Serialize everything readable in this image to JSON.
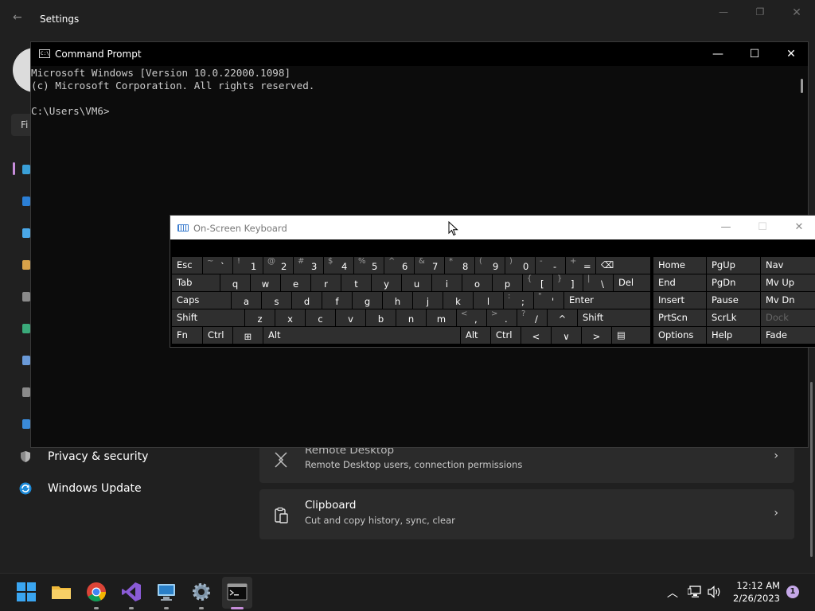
{
  "settings": {
    "title": "Settings",
    "find_placeholder_partial": "Fi",
    "nav": [
      {
        "label": "Privacy & security",
        "icon": "shield-icon"
      },
      {
        "label": "Windows Update",
        "icon": "windows-update-icon"
      }
    ],
    "cards": [
      {
        "title": "Remote Desktop",
        "subtitle": "Remote Desktop users, connection permissions",
        "icon": "remote-desktop-icon"
      },
      {
        "title": "Clipboard",
        "subtitle": "Cut and copy history, sync, clear",
        "icon": "clipboard-icon"
      }
    ],
    "accent_color": "#c78ddb"
  },
  "cmd": {
    "title": "Command Prompt",
    "lines": [
      "Microsoft Windows [Version 10.0.22000.1098]",
      "(c) Microsoft Corporation. All rights reserved.",
      "",
      "C:\\Users\\VM6>"
    ]
  },
  "osk": {
    "title": "On-Screen Keyboard",
    "rows": {
      "row1": [
        {
          "main": "Esc"
        },
        {
          "sh": "~",
          "main": "`"
        },
        {
          "sh": "!",
          "main": "1"
        },
        {
          "sh": "@",
          "main": "2"
        },
        {
          "sh": "#",
          "main": "3"
        },
        {
          "sh": "$",
          "main": "4"
        },
        {
          "sh": "%",
          "main": "5"
        },
        {
          "sh": "^",
          "main": "6"
        },
        {
          "sh": "&",
          "main": "7"
        },
        {
          "sh": "*",
          "main": "8"
        },
        {
          "sh": "(",
          "main": "9"
        },
        {
          "sh": ")",
          "main": "0"
        },
        {
          "sh": "-",
          "main": "-"
        },
        {
          "sh": "+",
          "main": "="
        },
        {
          "main": "⌫"
        }
      ],
      "row2": [
        {
          "main": "Tab"
        },
        {
          "main": "q"
        },
        {
          "main": "w"
        },
        {
          "main": "e"
        },
        {
          "main": "r"
        },
        {
          "main": "t"
        },
        {
          "main": "y"
        },
        {
          "main": "u"
        },
        {
          "main": "i"
        },
        {
          "main": "o"
        },
        {
          "main": "p"
        },
        {
          "sh": "{",
          "main": "["
        },
        {
          "sh": "}",
          "main": "]"
        },
        {
          "sh": "|",
          "main": "\\"
        },
        {
          "main": "Del"
        }
      ],
      "row3": [
        {
          "main": "Caps"
        },
        {
          "main": "a"
        },
        {
          "main": "s"
        },
        {
          "main": "d"
        },
        {
          "main": "f"
        },
        {
          "main": "g"
        },
        {
          "main": "h"
        },
        {
          "main": "j"
        },
        {
          "main": "k"
        },
        {
          "main": "l"
        },
        {
          "sh": ":",
          "main": ";"
        },
        {
          "sh": "\"",
          "main": "'"
        },
        {
          "main": "Enter"
        }
      ],
      "row4": [
        {
          "main": "Shift"
        },
        {
          "main": "z"
        },
        {
          "main": "x"
        },
        {
          "main": "c"
        },
        {
          "main": "v"
        },
        {
          "main": "b"
        },
        {
          "main": "n"
        },
        {
          "main": "m"
        },
        {
          "sh": "<",
          "main": ","
        },
        {
          "sh": ">",
          "main": "."
        },
        {
          "sh": "?",
          "main": "/"
        },
        {
          "main": "^"
        },
        {
          "main": "Shift"
        }
      ],
      "row5": [
        {
          "main": "Fn"
        },
        {
          "main": "Ctrl"
        },
        {
          "main": "⊞"
        },
        {
          "main": "Alt"
        },
        {
          "main": ""
        },
        {
          "main": "Alt"
        },
        {
          "main": "Ctrl"
        },
        {
          "main": "<"
        },
        {
          "main": "∨"
        },
        {
          "main": ">"
        },
        {
          "main": "▤"
        }
      ]
    },
    "nav_keys": [
      [
        "Home",
        "PgUp",
        "Nav"
      ],
      [
        "End",
        "PgDn",
        "Mv Up"
      ],
      [
        "Insert",
        "Pause",
        "Mv Dn"
      ],
      [
        "PrtScn",
        "ScrLk",
        "Dock"
      ],
      [
        "Options",
        "Help",
        "Fade"
      ]
    ]
  },
  "taskbar": {
    "apps": [
      {
        "name": "start",
        "icon": "windows-start-icon"
      },
      {
        "name": "file-explorer",
        "icon": "folder-icon"
      },
      {
        "name": "chrome",
        "icon": "chrome-icon"
      },
      {
        "name": "visual-studio",
        "icon": "visual-studio-icon"
      },
      {
        "name": "remote-desktop",
        "icon": "remote-desktop-icon"
      },
      {
        "name": "settings",
        "icon": "gear-icon"
      },
      {
        "name": "command-prompt",
        "icon": "terminal-icon"
      }
    ],
    "time": "12:12 AM",
    "date": "2/26/2023",
    "notification_count": "1"
  }
}
